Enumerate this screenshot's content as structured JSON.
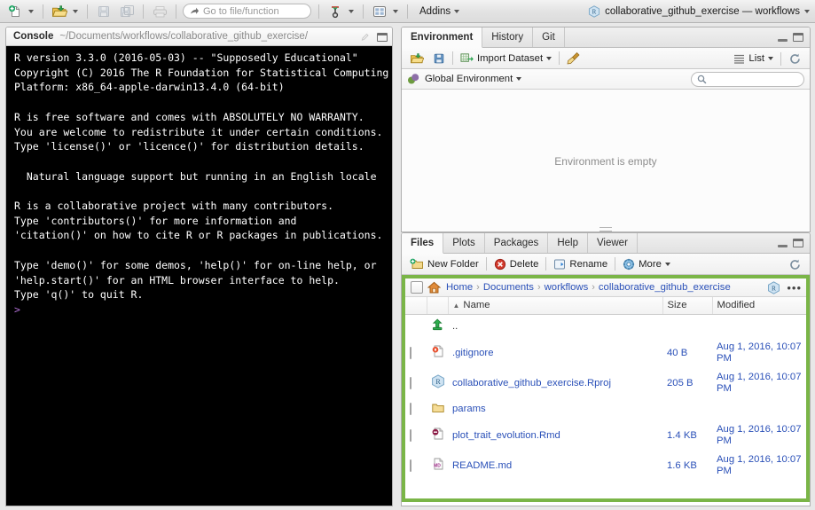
{
  "toolbar": {
    "new_file_label": "new-file",
    "open_label": "open-file",
    "save_label": "save",
    "save_all_label": "save-all",
    "print_label": "print",
    "goto_placeholder": "Go to file/function",
    "compile_label": "compile-report",
    "panes_label": "workspace-panes",
    "addins_label": "Addins",
    "project_name": "collaborative_github_exercise — workflows"
  },
  "console": {
    "title": "Console",
    "path": "~/Documents/workflows/collaborative_github_exercise/",
    "output": "R version 3.3.0 (2016-05-03) -- \"Supposedly Educational\"\nCopyright (C) 2016 The R Foundation for Statistical Computing\nPlatform: x86_64-apple-darwin13.4.0 (64-bit)\n\nR is free software and comes with ABSOLUTELY NO WARRANTY.\nYou are welcome to redistribute it under certain conditions.\nType 'license()' or 'licence()' for distribution details.\n\n  Natural language support but running in an English locale\n\nR is a collaborative project with many contributors.\nType 'contributors()' for more information and\n'citation()' on how to cite R or R packages in publications.\n\nType 'demo()' for some demos, 'help()' for on-line help, or\n'help.start()' for an HTML browser interface to help.\nType 'q()' to quit R.\n",
    "prompt": ">"
  },
  "environment": {
    "tabs": [
      {
        "label": "Environment",
        "active": true
      },
      {
        "label": "History",
        "active": false
      },
      {
        "label": "Git",
        "active": false
      }
    ],
    "toolbar": {
      "load_label": "load-workspace",
      "save_label": "save-workspace",
      "import_label": "Import Dataset",
      "broom_label": "clear-objects",
      "view_mode": "List",
      "refresh_label": "refresh"
    },
    "scope": "Global Environment",
    "search_placeholder": "",
    "empty_message": "Environment is empty"
  },
  "files": {
    "tabs": [
      {
        "label": "Files",
        "active": true
      },
      {
        "label": "Plots",
        "active": false
      },
      {
        "label": "Packages",
        "active": false
      },
      {
        "label": "Help",
        "active": false
      },
      {
        "label": "Viewer",
        "active": false
      }
    ],
    "toolbar": {
      "new_folder": "New Folder",
      "delete": "Delete",
      "rename": "Rename",
      "more": "More",
      "refresh_label": "refresh"
    },
    "breadcrumb": [
      "Home",
      "Documents",
      "workflows",
      "collaborative_github_exercise"
    ],
    "breadcrumb_separator": "›",
    "breadcrumb_more": "•••",
    "columns": [
      "",
      "",
      "Name",
      "Size",
      "Modified"
    ],
    "sort_indicator": "▲",
    "highlight_color": "#7ab547",
    "rows": [
      {
        "icon": "up-folder-icon",
        "name": "..",
        "size": "",
        "modified": "",
        "checkbox": false
      },
      {
        "icon": "gitignore-file-icon",
        "name": ".gitignore",
        "size": "40 B",
        "modified": "Aug 1, 2016, 10:07 PM",
        "checkbox": true
      },
      {
        "icon": "rproj-file-icon",
        "name": "collaborative_github_exercise.Rproj",
        "size": "205 B",
        "modified": "Aug 1, 2016, 10:07 PM",
        "checkbox": true
      },
      {
        "icon": "folder-icon",
        "name": "params",
        "size": "",
        "modified": "",
        "checkbox": true
      },
      {
        "icon": "rmd-file-icon",
        "name": "plot_trait_evolution.Rmd",
        "size": "1.4 KB",
        "modified": "Aug 1, 2016, 10:07 PM",
        "checkbox": true
      },
      {
        "icon": "md-file-icon",
        "name": "README.md",
        "size": "1.6 KB",
        "modified": "Aug 1, 2016, 10:07 PM",
        "checkbox": true
      }
    ]
  }
}
